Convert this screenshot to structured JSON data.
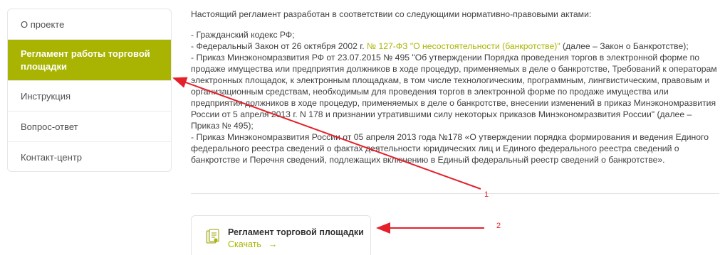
{
  "sidebar": {
    "items": [
      {
        "label": "О проекте"
      },
      {
        "label": "Регламент работы торговой площадки"
      },
      {
        "label": "Инструкция"
      },
      {
        "label": "Вопрос-ответ"
      },
      {
        "label": "Контакт-центр"
      }
    ],
    "active_color": "#a9b402"
  },
  "main": {
    "intro": "Настоящий регламент разработан в соответствии со следующими нормативно-правовыми актами:",
    "laws": [
      {
        "text": "- Гражданский кодекс РФ;"
      },
      {
        "before": "- Федеральный Закон от 26 октября 2002 г. ",
        "link": "№ 127-ФЗ \"О несостоятельности (банкротстве)\"",
        "after": " (далее – Закон о Банкротстве);"
      },
      {
        "text": "- Приказ Минэкономразвития РФ от 23.07.2015 № 495 \"Об утверждении Порядка проведения торгов в электронной форме по продаже имущества или предприятия должников в ходе процедур, применяемых в деле о банкротстве, Требований к операторам электронных площадок, к электронным площадкам, в том числе технологическим, программным, лингвистическим, правовым и организационным средствам, необходимым для проведения торгов в электронной форме по продаже имущества или предприятия должников в ходе процедур, применяемых в деле о банкротстве, внесении изменений в приказ Минэкономразвития России от 5 апреля 2013 г. N 178 и признании утратившими силу некоторых приказов Минэкономразвития России\" (далее – Приказ № 495);"
      },
      {
        "text": "- Приказ Минэкономразвития России от 05 апреля 2013 года №178 «О утверждении порядка формирования и ведения Единого федерального реестра сведений о фактах деятельности юридических лиц и Единого федерального реестра сведений о банкротстве и Перечня сведений, подлежащих включению в Единый федеральный реестр сведений о банкротстве»."
      }
    ]
  },
  "document": {
    "title": "Регламент торговой площадки",
    "download_label": "Скачать",
    "download_arrow": "→",
    "icon": "document-icon"
  },
  "annotations": {
    "label1": "1",
    "label2": "2",
    "color": "#e4212b"
  }
}
